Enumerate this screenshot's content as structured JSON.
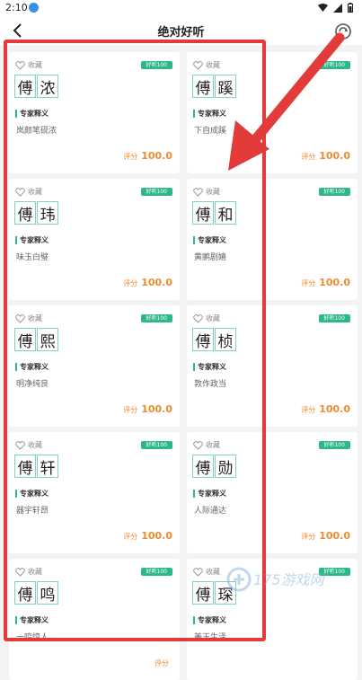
{
  "status": {
    "time": "2:10"
  },
  "header": {
    "title": "绝对好听"
  },
  "cards": [
    {
      "fav": "收藏",
      "tag": "好听100",
      "surname": "傅",
      "given": "浓",
      "expert": "专家释义",
      "meaning": "岚颜笔砚浓",
      "score_label": "评分",
      "score": "100.0"
    },
    {
      "fav": "收藏",
      "tag": "好听100",
      "surname": "傅",
      "given": "蹊",
      "expert": "专家释义",
      "meaning": "下自成蹊",
      "score_label": "评分",
      "score": "100.0"
    },
    {
      "fav": "收藏",
      "tag": "好听100",
      "surname": "傅",
      "given": "玮",
      "expert": "专家释义",
      "meaning": "味玉白璧",
      "score_label": "评分",
      "score": "100.0"
    },
    {
      "fav": "收藏",
      "tag": "好听100",
      "surname": "傅",
      "given": "和",
      "expert": "专家释义",
      "meaning": "黄鹂剧嬉",
      "score_label": "评分",
      "score": "100.0"
    },
    {
      "fav": "收藏",
      "tag": "好听100",
      "surname": "傅",
      "given": "熙",
      "expert": "专家释义",
      "meaning": "明净纯良",
      "score_label": "评分",
      "score": "100.0"
    },
    {
      "fav": "收藏",
      "tag": "好听100",
      "surname": "傅",
      "given": "桢",
      "expert": "专家释义",
      "meaning": "敦作政当",
      "score_label": "评分",
      "score": "100.0"
    },
    {
      "fav": "收藏",
      "tag": "好听100",
      "surname": "傅",
      "given": "轩",
      "expert": "专家释义",
      "meaning": "器宇轩昂",
      "score_label": "评分",
      "score": "100.0"
    },
    {
      "fav": "收藏",
      "tag": "好听100",
      "surname": "傅",
      "given": "勋",
      "expert": "专家释义",
      "meaning": "人际通达",
      "score_label": "评分",
      "score": "100.0"
    },
    {
      "fav": "收藏",
      "tag": "好听100",
      "surname": "傅",
      "given": "鸣",
      "expert": "专家释义",
      "meaning": "一鸣惊人",
      "score_label": "评分",
      "score": ""
    },
    {
      "fav": "收藏",
      "tag": "好听100",
      "surname": "傅",
      "given": "琛",
      "expert": "专家释义",
      "meaning": "美玉生泽",
      "score_label": "",
      "score": ""
    }
  ],
  "watermark": {
    "text": "175游戏网"
  },
  "colors": {
    "accent": "#2db88a",
    "score": "#f08a2e",
    "highlight": "#e33a3a"
  }
}
